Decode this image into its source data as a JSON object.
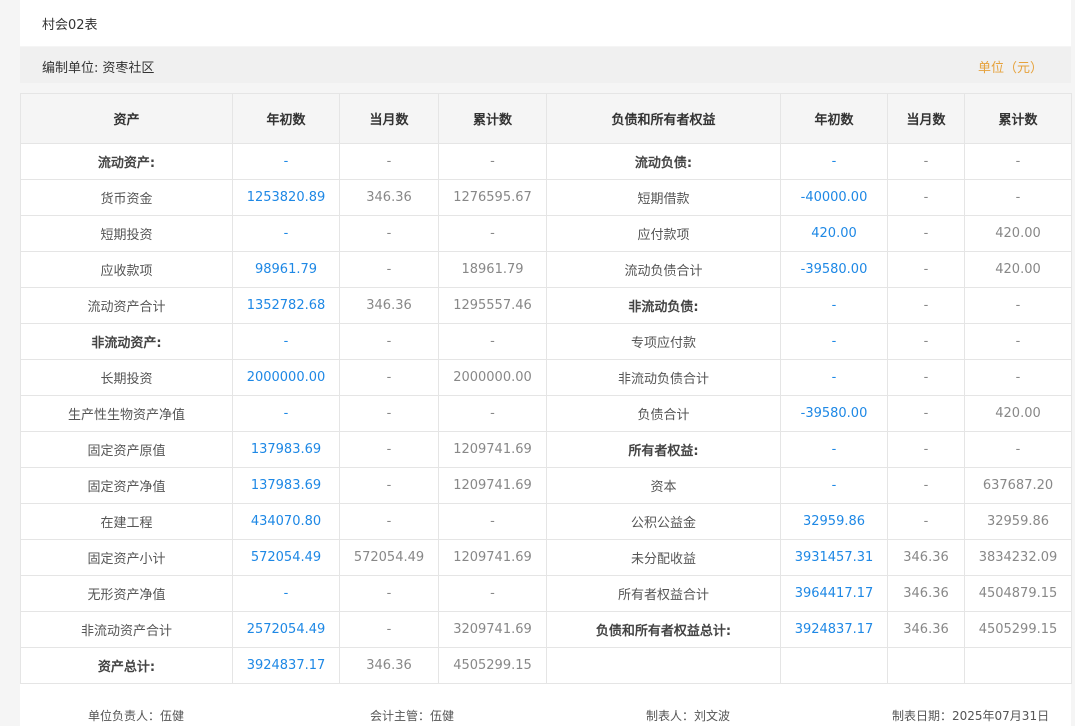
{
  "header": {
    "title": "村会02表"
  },
  "info": {
    "org_label": "编制单位:",
    "org_name": "资枣社区",
    "currency": "单位（元）"
  },
  "columns": [
    "资产",
    "年初数",
    "当月数",
    "累计数",
    "负债和所有者权益",
    "年初数",
    "当月数",
    "累计数"
  ],
  "rows": [
    {
      "l": [
        "流动资产:",
        "-",
        "-",
        "-"
      ],
      "lb": true,
      "r": [
        "流动负债:",
        "-",
        "-",
        "-"
      ],
      "rb": true
    },
    {
      "l": [
        "货币资金",
        "1253820.89",
        "346.36",
        "1276595.67"
      ],
      "r": [
        "短期借款",
        "-40000.00",
        "-",
        "-"
      ]
    },
    {
      "l": [
        "短期投资",
        "-",
        "-",
        "-"
      ],
      "r": [
        "应付款项",
        "420.00",
        "-",
        "420.00"
      ]
    },
    {
      "l": [
        "应收款项",
        "98961.79",
        "-",
        "18961.79"
      ],
      "r": [
        "流动负债合计",
        "-39580.00",
        "-",
        "420.00"
      ]
    },
    {
      "l": [
        "流动资产合计",
        "1352782.68",
        "346.36",
        "1295557.46"
      ],
      "r": [
        "非流动负债:",
        "-",
        "-",
        "-"
      ],
      "rb": true
    },
    {
      "l": [
        "非流动资产:",
        "-",
        "-",
        "-"
      ],
      "lb": true,
      "r": [
        "专项应付款",
        "-",
        "-",
        "-"
      ]
    },
    {
      "l": [
        "长期投资",
        "2000000.00",
        "-",
        "2000000.00"
      ],
      "r": [
        "非流动负债合计",
        "-",
        "-",
        "-"
      ]
    },
    {
      "l": [
        "生产性生物资产净值",
        "-",
        "-",
        "-"
      ],
      "r": [
        "负债合计",
        "-39580.00",
        "-",
        "420.00"
      ]
    },
    {
      "l": [
        "固定资产原值",
        "137983.69",
        "-",
        "1209741.69"
      ],
      "r": [
        "所有者权益:",
        "-",
        "-",
        "-"
      ],
      "rb": true
    },
    {
      "l": [
        "固定资产净值",
        "137983.69",
        "-",
        "1209741.69"
      ],
      "r": [
        "资本",
        "-",
        "-",
        "637687.20"
      ]
    },
    {
      "l": [
        "在建工程",
        "434070.80",
        "-",
        "-"
      ],
      "r": [
        "公积公益金",
        "32959.86",
        "-",
        "32959.86"
      ]
    },
    {
      "l": [
        "固定资产小计",
        "572054.49",
        "572054.49",
        "1209741.69"
      ],
      "r": [
        "未分配收益",
        "3931457.31",
        "346.36",
        "3834232.09"
      ]
    },
    {
      "l": [
        "无形资产净值",
        "-",
        "-",
        "-"
      ],
      "r": [
        "所有者权益合计",
        "3964417.17",
        "346.36",
        "4504879.15"
      ]
    },
    {
      "l": [
        "非流动资产合计",
        "2572054.49",
        "-",
        "3209741.69"
      ],
      "r": [
        "负债和所有者权益总计:",
        "3924837.17",
        "346.36",
        "4505299.15"
      ],
      "rb": true
    },
    {
      "l": [
        "资产总计:",
        "3924837.17",
        "346.36",
        "4505299.15"
      ],
      "lb": true,
      "r": [
        "",
        "",
        "",
        ""
      ]
    }
  ],
  "footer": {
    "unit_head": "单位负责人：伍健",
    "accountant": "会计主管：伍健",
    "preparer": "制表人：刘文波",
    "date": "制表日期：2025年07月31日"
  },
  "colors": {
    "accent_blue": "#1e88e5",
    "currency_orange": "#e6a23c",
    "header_bg": "#f5f5f5"
  }
}
